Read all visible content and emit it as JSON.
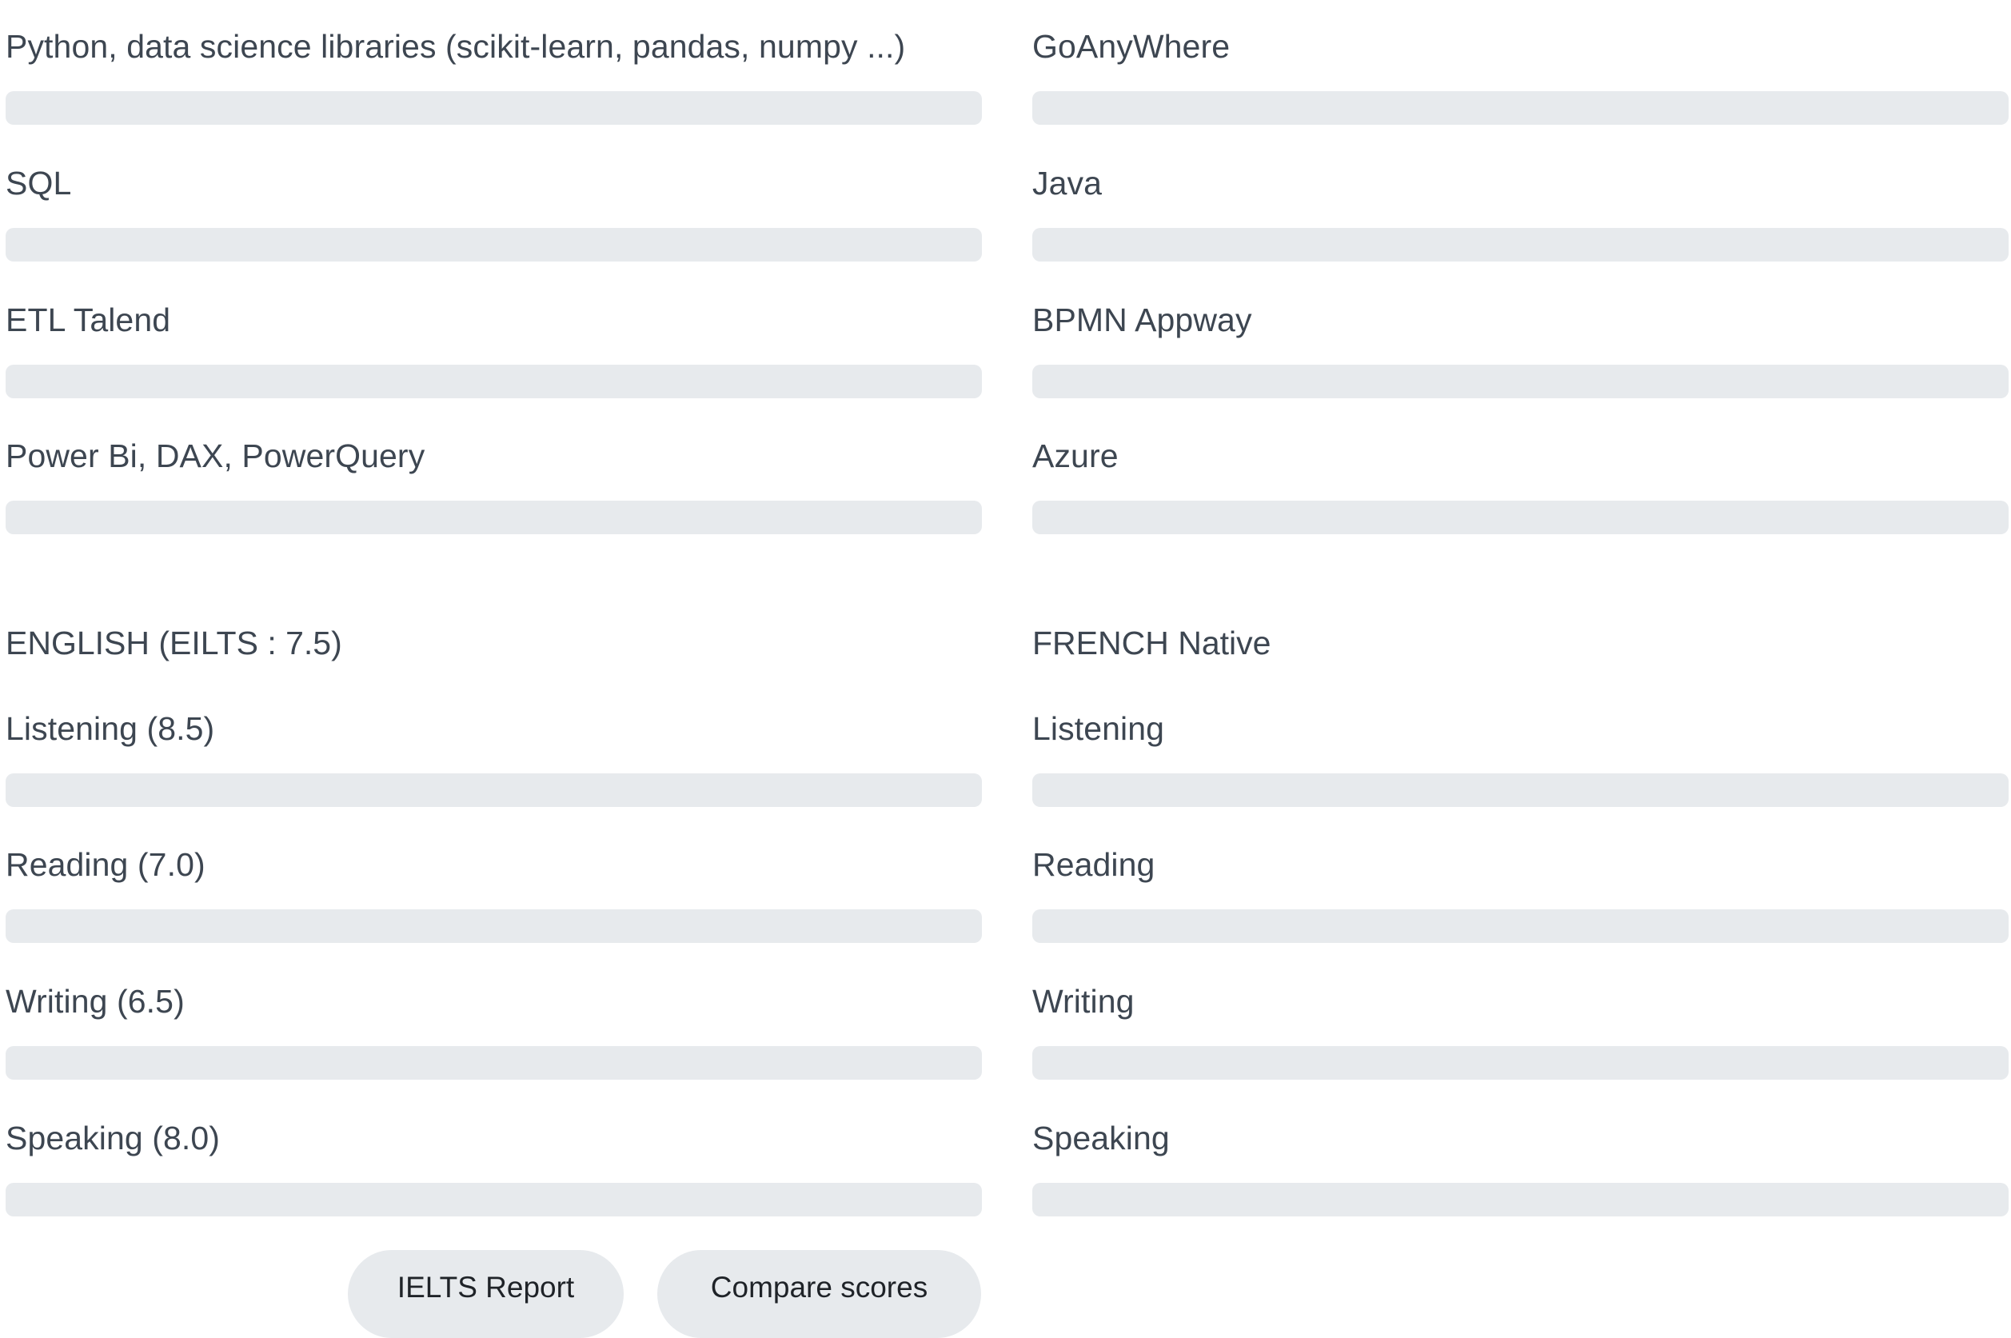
{
  "technical_skills": {
    "left": [
      {
        "label": "Python, data science libraries (scikit-learn, pandas, numpy ...)"
      },
      {
        "label": "SQL"
      },
      {
        "label": "ETL Talend"
      },
      {
        "label": "Power Bi, DAX, PowerQuery"
      }
    ],
    "right": [
      {
        "label": "GoAnyWhere"
      },
      {
        "label": "Java"
      },
      {
        "label": "BPMN Appway"
      },
      {
        "label": "Azure"
      }
    ]
  },
  "languages": {
    "english": {
      "heading": "ENGLISH (EILTS : 7.5)",
      "skills": [
        {
          "label": "Listening (8.5)"
        },
        {
          "label": "Reading (7.0)"
        },
        {
          "label": "Writing (6.5)"
        },
        {
          "label": "Speaking (8.0)"
        }
      ]
    },
    "french": {
      "heading": "FRENCH Native",
      "skills": [
        {
          "label": "Listening"
        },
        {
          "label": "Reading"
        },
        {
          "label": "Writing"
        },
        {
          "label": "Speaking"
        }
      ]
    }
  },
  "buttons": {
    "ielts_report": "IELTS Report",
    "compare_scores": "Compare scores"
  },
  "colors": {
    "text": "#3d4651",
    "track": "#e7eaed",
    "button_bg": "#e7eaed"
  }
}
